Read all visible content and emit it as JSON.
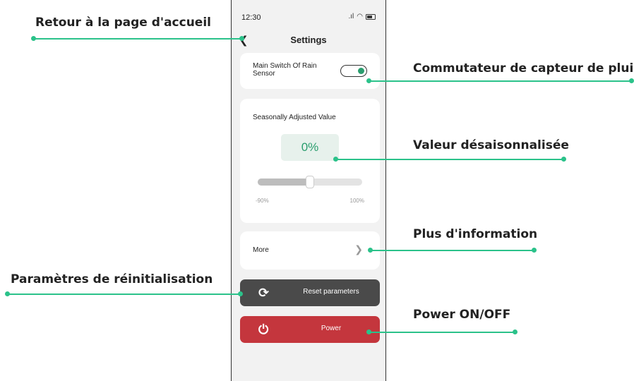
{
  "status_bar": {
    "time": "12:30",
    "signal_icon": "signal-icon",
    "wifi_icon": "wifi-icon",
    "battery_icon": "battery-icon"
  },
  "header": {
    "back_icon": "back-chevron-icon",
    "title": "Settings"
  },
  "rain_switch": {
    "label": "Main Switch Of Rain Sensor",
    "state": "on"
  },
  "seasonal": {
    "label": "Seasonally Adjusted Value",
    "value": "0%",
    "slider_level": 0.5,
    "min_label": "-90%",
    "max_label": "100%"
  },
  "more": {
    "label": "More",
    "chevron_icon": "chevron-right-icon"
  },
  "reset": {
    "label": "Reset parameters",
    "icon": "refresh-icon"
  },
  "power": {
    "label": "Power",
    "icon": "power-icon"
  },
  "callouts": {
    "home": "Retour à la page d'accueil",
    "rain_switch": "Commutateur de capteur de pluie",
    "seasonal": "Valeur désaisonnalisée",
    "more": "Plus d'information",
    "reset": "Paramètres de réinitialisation",
    "power": "Power ON/OFF"
  },
  "colors": {
    "accent": "#2bc28a",
    "value_green": "#2a9d6e",
    "reset_bg": "#4a4a4a",
    "power_bg": "#c4363d",
    "screen_bg": "#f2f2f2"
  }
}
